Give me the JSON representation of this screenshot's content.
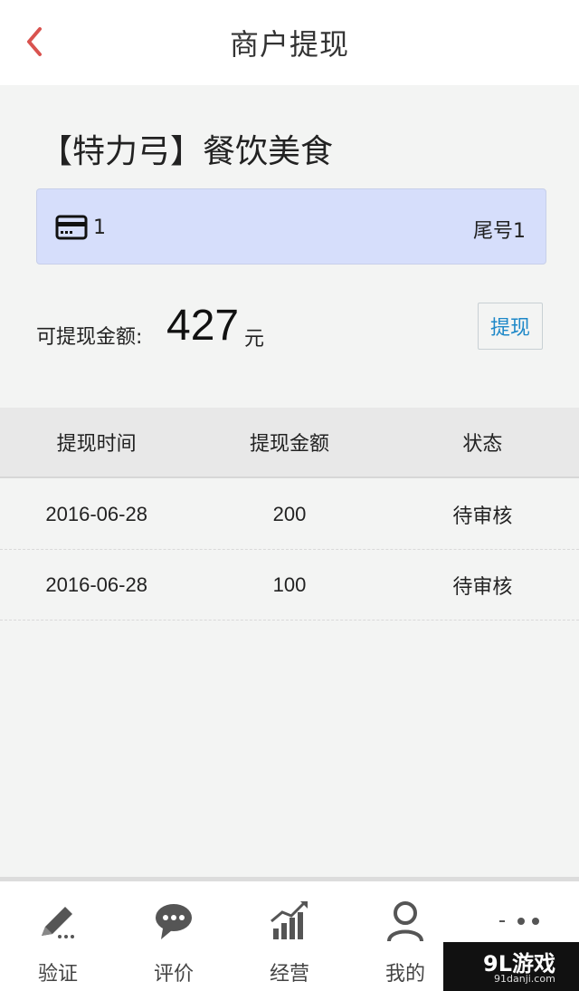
{
  "header": {
    "title": "商户提现"
  },
  "merchant": {
    "name": "【特力弓】餐饮美食"
  },
  "card": {
    "number": "1",
    "tail": "尾号1"
  },
  "balance": {
    "label": "可提现金额:",
    "value": "427",
    "unit": "元",
    "withdraw_label": "提现"
  },
  "table": {
    "headers": [
      "提现时间",
      "提现金额",
      "状态"
    ],
    "rows": [
      {
        "date": "2016-06-28",
        "amount": "200",
        "status": "待审核"
      },
      {
        "date": "2016-06-28",
        "amount": "100",
        "status": "待审核"
      }
    ]
  },
  "nav": {
    "items": [
      {
        "label": "验证",
        "icon": "pencil-icon"
      },
      {
        "label": "评价",
        "icon": "chat-bubble-icon"
      },
      {
        "label": "经营",
        "icon": "bar-chart-icon"
      },
      {
        "label": "我的",
        "icon": "user-icon"
      },
      {
        "label": "",
        "icon": "more-icon"
      }
    ]
  },
  "watermark": {
    "main": "9L游戏",
    "sub": "91danji.com"
  },
  "colors": {
    "back_arrow": "#d9534f",
    "card_bg": "#d6defb",
    "button_text": "#1e88c8"
  }
}
